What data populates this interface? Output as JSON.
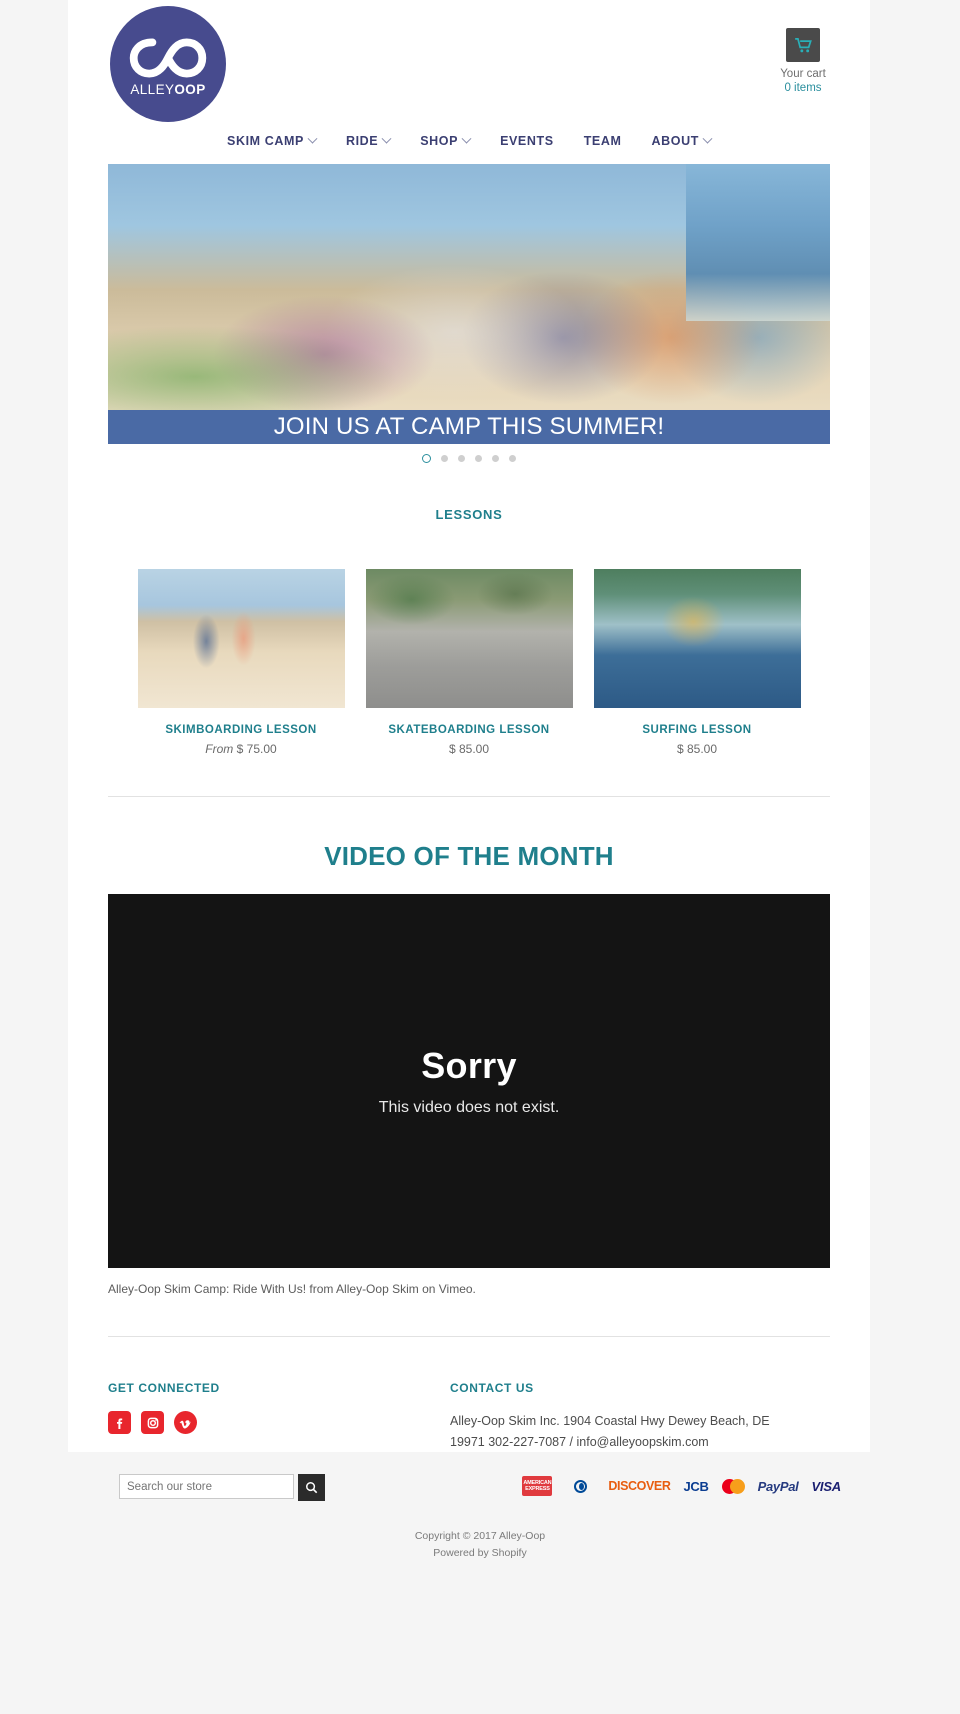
{
  "brand": {
    "logo_text_light": "ALLEY",
    "logo_text_bold": "OOP",
    "logo_icon": "infinity-loop-icon",
    "logo_bg_color": "#474b8e"
  },
  "header": {
    "cart": {
      "icon": "shopping-cart-icon",
      "label": "Your cart",
      "count_label": "0 items"
    }
  },
  "nav": {
    "items": [
      {
        "label": "SKIM CAMP",
        "has_dropdown": true
      },
      {
        "label": "RIDE",
        "has_dropdown": true
      },
      {
        "label": "SHOP",
        "has_dropdown": true
      },
      {
        "label": "EVENTS",
        "has_dropdown": false
      },
      {
        "label": "TEAM",
        "has_dropdown": false
      },
      {
        "label": "ABOUT",
        "has_dropdown": true
      }
    ]
  },
  "hero": {
    "banner_text": "JOIN US AT CAMP THIS SUMMER!",
    "slide_count": 6,
    "active_slide": 1,
    "bar_color": "#4a6aa5",
    "active_dot_color": "#2b8f9e"
  },
  "lessons": {
    "section_title": "LESSONS",
    "products": [
      {
        "title": "SKIMBOARDING LESSON",
        "price_prefix": "From ",
        "price": "$ 75.00",
        "image": "skimboarding-beach-photo"
      },
      {
        "title": "SKATEBOARDING LESSON",
        "price_prefix": "",
        "price": "$ 85.00",
        "image": "skateboarding-park-photo"
      },
      {
        "title": "SURFING LESSON",
        "price_prefix": "",
        "price": "$ 85.00",
        "image": "surfing-wave-photo"
      }
    ]
  },
  "video": {
    "section_title": "VIDEO OF THE MONTH",
    "error_heading": "Sorry",
    "error_message": "This video does not exist.",
    "caption": "Alley-Oop Skim Camp: Ride With Us! from Alley-Oop Skim on Vimeo."
  },
  "footer": {
    "get_connected": {
      "heading": "GET CONNECTED",
      "socials": [
        {
          "name": "facebook-icon",
          "glyph": "f",
          "color": "#e8262d",
          "shape": "rounded"
        },
        {
          "name": "instagram-icon",
          "glyph": "◉",
          "color": "#e8262d",
          "shape": "rounded"
        },
        {
          "name": "vimeo-icon",
          "glyph": "V",
          "color": "#e8262d",
          "shape": "circle"
        }
      ]
    },
    "contact": {
      "heading": "CONTACT US",
      "line1": "Alley-Oop Skim Inc. 1904 Coastal Hwy Dewey Beach, DE",
      "line2": "19971 302-227-7087 / info@alleyoopskim.com"
    }
  },
  "bottom": {
    "search": {
      "placeholder": "Search our store",
      "value": "",
      "button_icon": "search-icon"
    },
    "payments": [
      {
        "name": "american-express-icon",
        "label": "AMERICAN EXPRESS"
      },
      {
        "name": "diners-club-icon",
        "label": "Diners Club"
      },
      {
        "name": "discover-icon",
        "label": "DISCOVER"
      },
      {
        "name": "jcb-icon",
        "label": "JCB"
      },
      {
        "name": "mastercard-icon",
        "label": "Mastercard"
      },
      {
        "name": "paypal-icon",
        "label": "PayPal"
      },
      {
        "name": "visa-icon",
        "label": "VISA"
      }
    ],
    "copyright": "Copyright © 2017 Alley-Oop",
    "powered_by_prefix": "Powered by ",
    "powered_by_link": "Shopify"
  }
}
